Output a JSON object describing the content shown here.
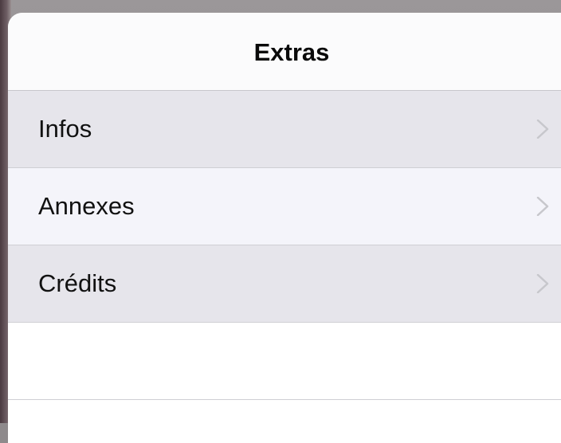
{
  "popover": {
    "title": "Extras"
  },
  "menu": {
    "items": [
      {
        "label": "Infos",
        "icon": "chevron-right-icon"
      },
      {
        "label": "Annexes",
        "icon": "chevron-right-icon"
      },
      {
        "label": "Crédits",
        "icon": "chevron-right-icon"
      }
    ]
  },
  "colors": {
    "row_shaded": "#e6e5eb",
    "row_light": "#f4f4fa",
    "chevron": "#c7c7cc",
    "separator": "#cfcfd4"
  }
}
